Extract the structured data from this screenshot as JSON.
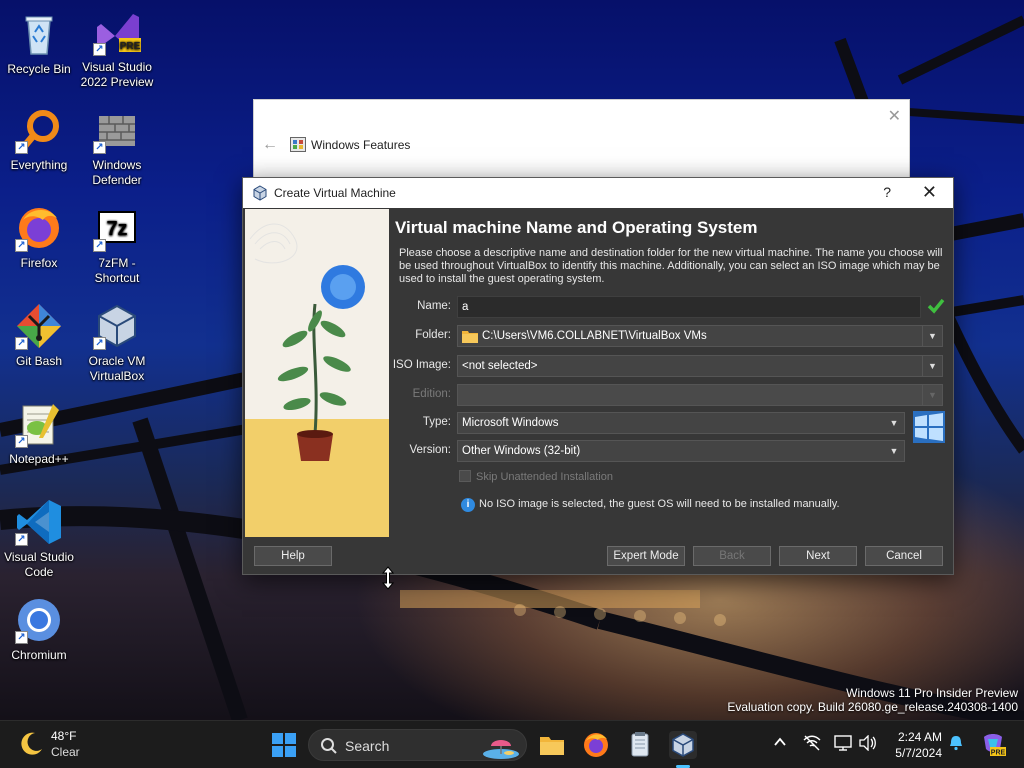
{
  "desktop": {
    "icons": [
      {
        "label": "Recycle Bin",
        "icon": "recycle-bin-icon",
        "shortcut": false
      },
      {
        "label": "Visual Studio 2022 Preview",
        "icon": "visual-studio-preview-icon",
        "shortcut": true,
        "badge": "PRE"
      },
      {
        "label": "Everything",
        "icon": "everything-search-icon",
        "shortcut": true
      },
      {
        "label": "Windows Defender",
        "icon": "windows-defender-icon",
        "shortcut": true
      },
      {
        "label": "Firefox",
        "icon": "firefox-icon",
        "shortcut": true
      },
      {
        "label": "7zFM - Shortcut",
        "icon": "7zip-icon",
        "shortcut": true,
        "badge": "7z"
      },
      {
        "label": "Git Bash",
        "icon": "git-bash-icon",
        "shortcut": true
      },
      {
        "label": "Oracle VM VirtualBox",
        "icon": "virtualbox-icon",
        "shortcut": true
      },
      {
        "label": "Notepad++",
        "icon": "notepad-plus-plus-icon",
        "shortcut": true
      },
      {
        "label": "Visual Studio Code",
        "icon": "vscode-icon",
        "shortcut": true
      },
      {
        "label": "Chromium",
        "icon": "chromium-icon",
        "shortcut": true
      }
    ]
  },
  "windows_features": {
    "title": "Windows Features"
  },
  "dialog": {
    "title": "Create Virtual Machine",
    "help_glyph": "?",
    "close_glyph": "✕",
    "heading": "Virtual machine Name and Operating System",
    "description": "Please choose a descriptive name and destination folder for the new virtual machine. The name you choose will be used throughout VirtualBox to identify this machine. Additionally, you can select an ISO image which may be used to install the guest operating system.",
    "fields": {
      "name": {
        "label": "Name:",
        "value": "a",
        "valid": true
      },
      "folder": {
        "label": "Folder:",
        "value": "C:\\Users\\VM6.COLLABNET\\VirtualBox VMs"
      },
      "iso": {
        "label": "ISO Image:",
        "value": "<not selected>"
      },
      "edition": {
        "label": "Edition:",
        "value": "",
        "disabled": true
      },
      "type": {
        "label": "Type:",
        "value": "Microsoft Windows"
      },
      "version": {
        "label": "Version:",
        "value": "Other Windows (32-bit)"
      }
    },
    "skip_unattended": {
      "label": "Skip Unattended Installation",
      "checked": false,
      "disabled": true
    },
    "info_message": "No ISO image is selected, the guest OS will need to be installed manually.",
    "buttons": {
      "help": "Help",
      "expert_mode": "Expert Mode",
      "back": "Back",
      "next": "Next",
      "cancel": "Cancel"
    }
  },
  "watermark": {
    "line1": "Windows 11 Pro Insider Preview",
    "line2": "Evaluation copy. Build 26080.ge_release.240308-1400"
  },
  "taskbar": {
    "weather": {
      "temp": "48°F",
      "condition": "Clear"
    },
    "search_placeholder": "Search",
    "clock": {
      "time": "2:24 AM",
      "date": "5/7/2024"
    },
    "apps": [
      "start-icon",
      "search-icon",
      "file-explorer-icon",
      "firefox-icon",
      "notepad-icon",
      "virtualbox-icon"
    ],
    "tray": [
      "chevron-up-icon",
      "network-off-icon",
      "display-icon",
      "volume-icon",
      "notification-bell-icon",
      "copilot-icon"
    ],
    "copilot_badge": "PRE"
  },
  "colors": {
    "dialog_bg": "#373737",
    "accent_blue": "#2f8ae0",
    "valid_green": "#3fbf3f"
  }
}
